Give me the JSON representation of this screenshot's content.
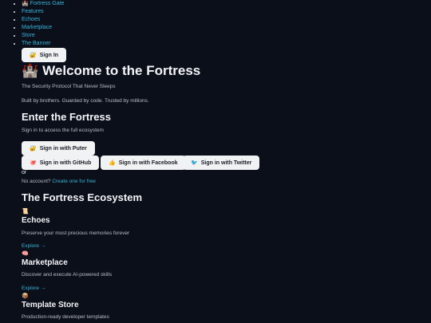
{
  "nav": {
    "items": [
      {
        "icon": "castle-icon",
        "glyph": "🏰",
        "label": "Fortress Gate"
      },
      {
        "label": "Features"
      },
      {
        "label": "Echoes"
      },
      {
        "label": "Marketplace"
      },
      {
        "label": "Store"
      },
      {
        "label": "The Banner"
      }
    ],
    "sign_in": {
      "icon": "lock-icon",
      "glyph": "🔐",
      "label": "Sign In"
    }
  },
  "hero": {
    "icon": "castle-icon",
    "glyph": "🏰",
    "title": "Welcome to the Fortress",
    "tagline": "The Security Protocol That Never Sleeps",
    "subtitle": "Built by brothers. Guarded by code. Trusted by millions."
  },
  "auth": {
    "title": "Enter the Fortress",
    "description": "Sign in to access the full ecosystem",
    "puter": {
      "glyph": "🔐",
      "label": "Sign in with Puter"
    },
    "github": {
      "glyph": "🐙",
      "label": "Sign in with GitHub"
    },
    "facebook": {
      "glyph": "👍",
      "label": "Sign in with Facebook"
    },
    "twitter": {
      "glyph": "🐦",
      "label": "Sign in with Twitter"
    },
    "or_text": "or",
    "no_account": "No account?",
    "create_link": "Create one for free"
  },
  "ecosystem": {
    "title": "The Fortress Ecosystem",
    "items": [
      {
        "glyph": "📜",
        "icon": "scroll-icon",
        "title": "Echoes",
        "description": "Preserve your most precious memories forever",
        "link": "Explore →"
      },
      {
        "glyph": "🧠",
        "icon": "brain-icon",
        "title": "Marketplace",
        "description": "Discover and execute AI-powered skills",
        "link": "Explore →"
      },
      {
        "glyph": "📦",
        "icon": "package-icon",
        "title": "Template Store",
        "description": "Production-ready developer templates"
      }
    ]
  }
}
